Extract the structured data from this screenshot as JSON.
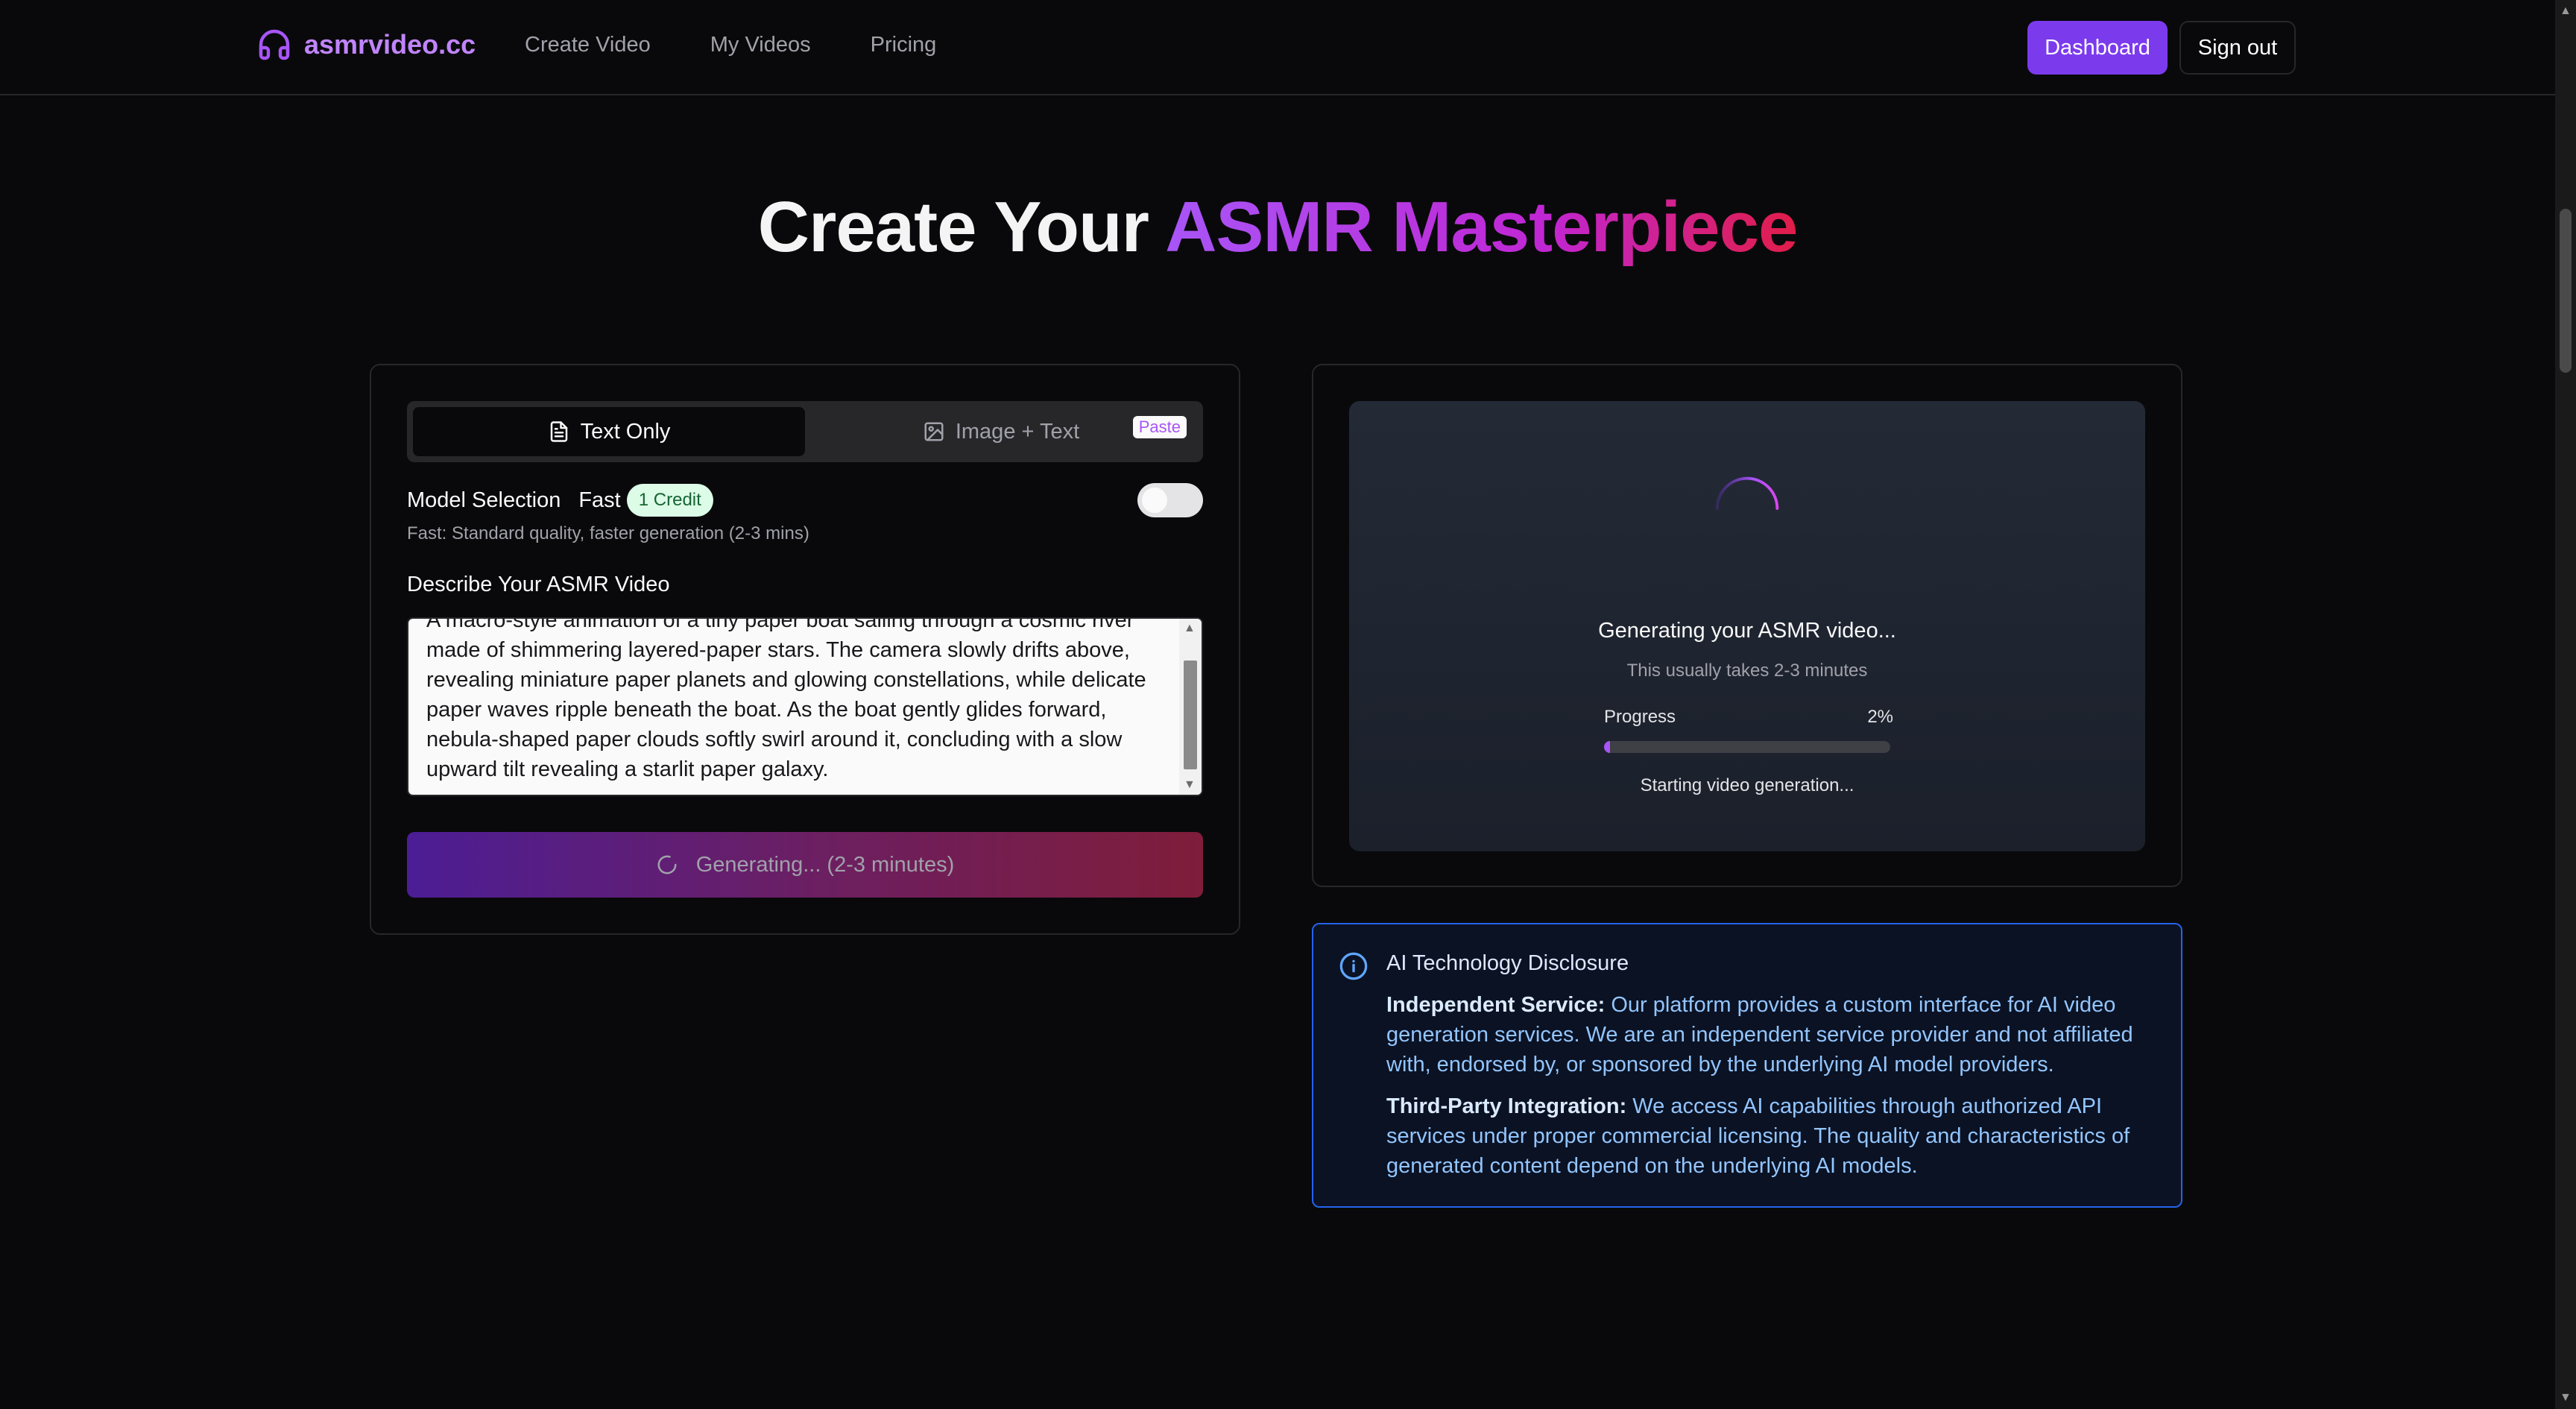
{
  "header": {
    "brand": "asmrvideo.cc",
    "nav": [
      "Create Video",
      "My Videos",
      "Pricing"
    ],
    "dashboard_label": "Dashboard",
    "signout_label": "Sign out"
  },
  "title": {
    "prefix": "Create Your ",
    "accent": "ASMR Masterpiece"
  },
  "form": {
    "tabs": [
      {
        "label": "Text Only",
        "icon": "document-icon"
      },
      {
        "label": "Image + Text",
        "icon": "image-icon"
      }
    ],
    "paste_badge": "Paste",
    "model_label": "Model Selection",
    "model_value": "Fast",
    "credit_badge": "1 Credit",
    "model_toggle_on": false,
    "model_desc": "Fast: Standard quality, faster generation (2-3 mins)",
    "describe_label": "Describe Your ASMR Video",
    "prompt": "A macro-style animation of a tiny paper boat sailing through a cosmic river made of shimmering layered-paper stars. The camera slowly drifts above, revealing miniature paper planets and glowing constellations, while delicate paper waves ripple beneath the boat. As the boat gently glides forward, nebula-shaped paper clouds softly swirl around it, concluding with a slow upward tilt revealing a starlit paper galaxy.",
    "generate_label": "Generating... (2-3 minutes)"
  },
  "generation": {
    "title": "Generating your ASMR video...",
    "subtitle": "This usually takes 2-3 minutes",
    "progress_label": "Progress",
    "progress_text": "2%",
    "progress_fraction": 0.02,
    "status": "Starting video generation..."
  },
  "disclosure": {
    "title": "AI Technology Disclosure",
    "p1_bold": "Independent Service:",
    "p1_text": " Our platform provides a custom interface for AI video generation services. We are an independent service provider and not affiliated with, endorsed by, or sponsored by the underlying AI model providers.",
    "p2_bold": "Third-Party Integration:",
    "p2_text": " We access AI capabilities through authorized API services under proper commercial licensing. The quality and characteristics of generated content depend on the underlying AI models."
  },
  "colors": {
    "accent": "#7c3aed",
    "brand": "#c084fc",
    "info_border": "#2563eb"
  }
}
